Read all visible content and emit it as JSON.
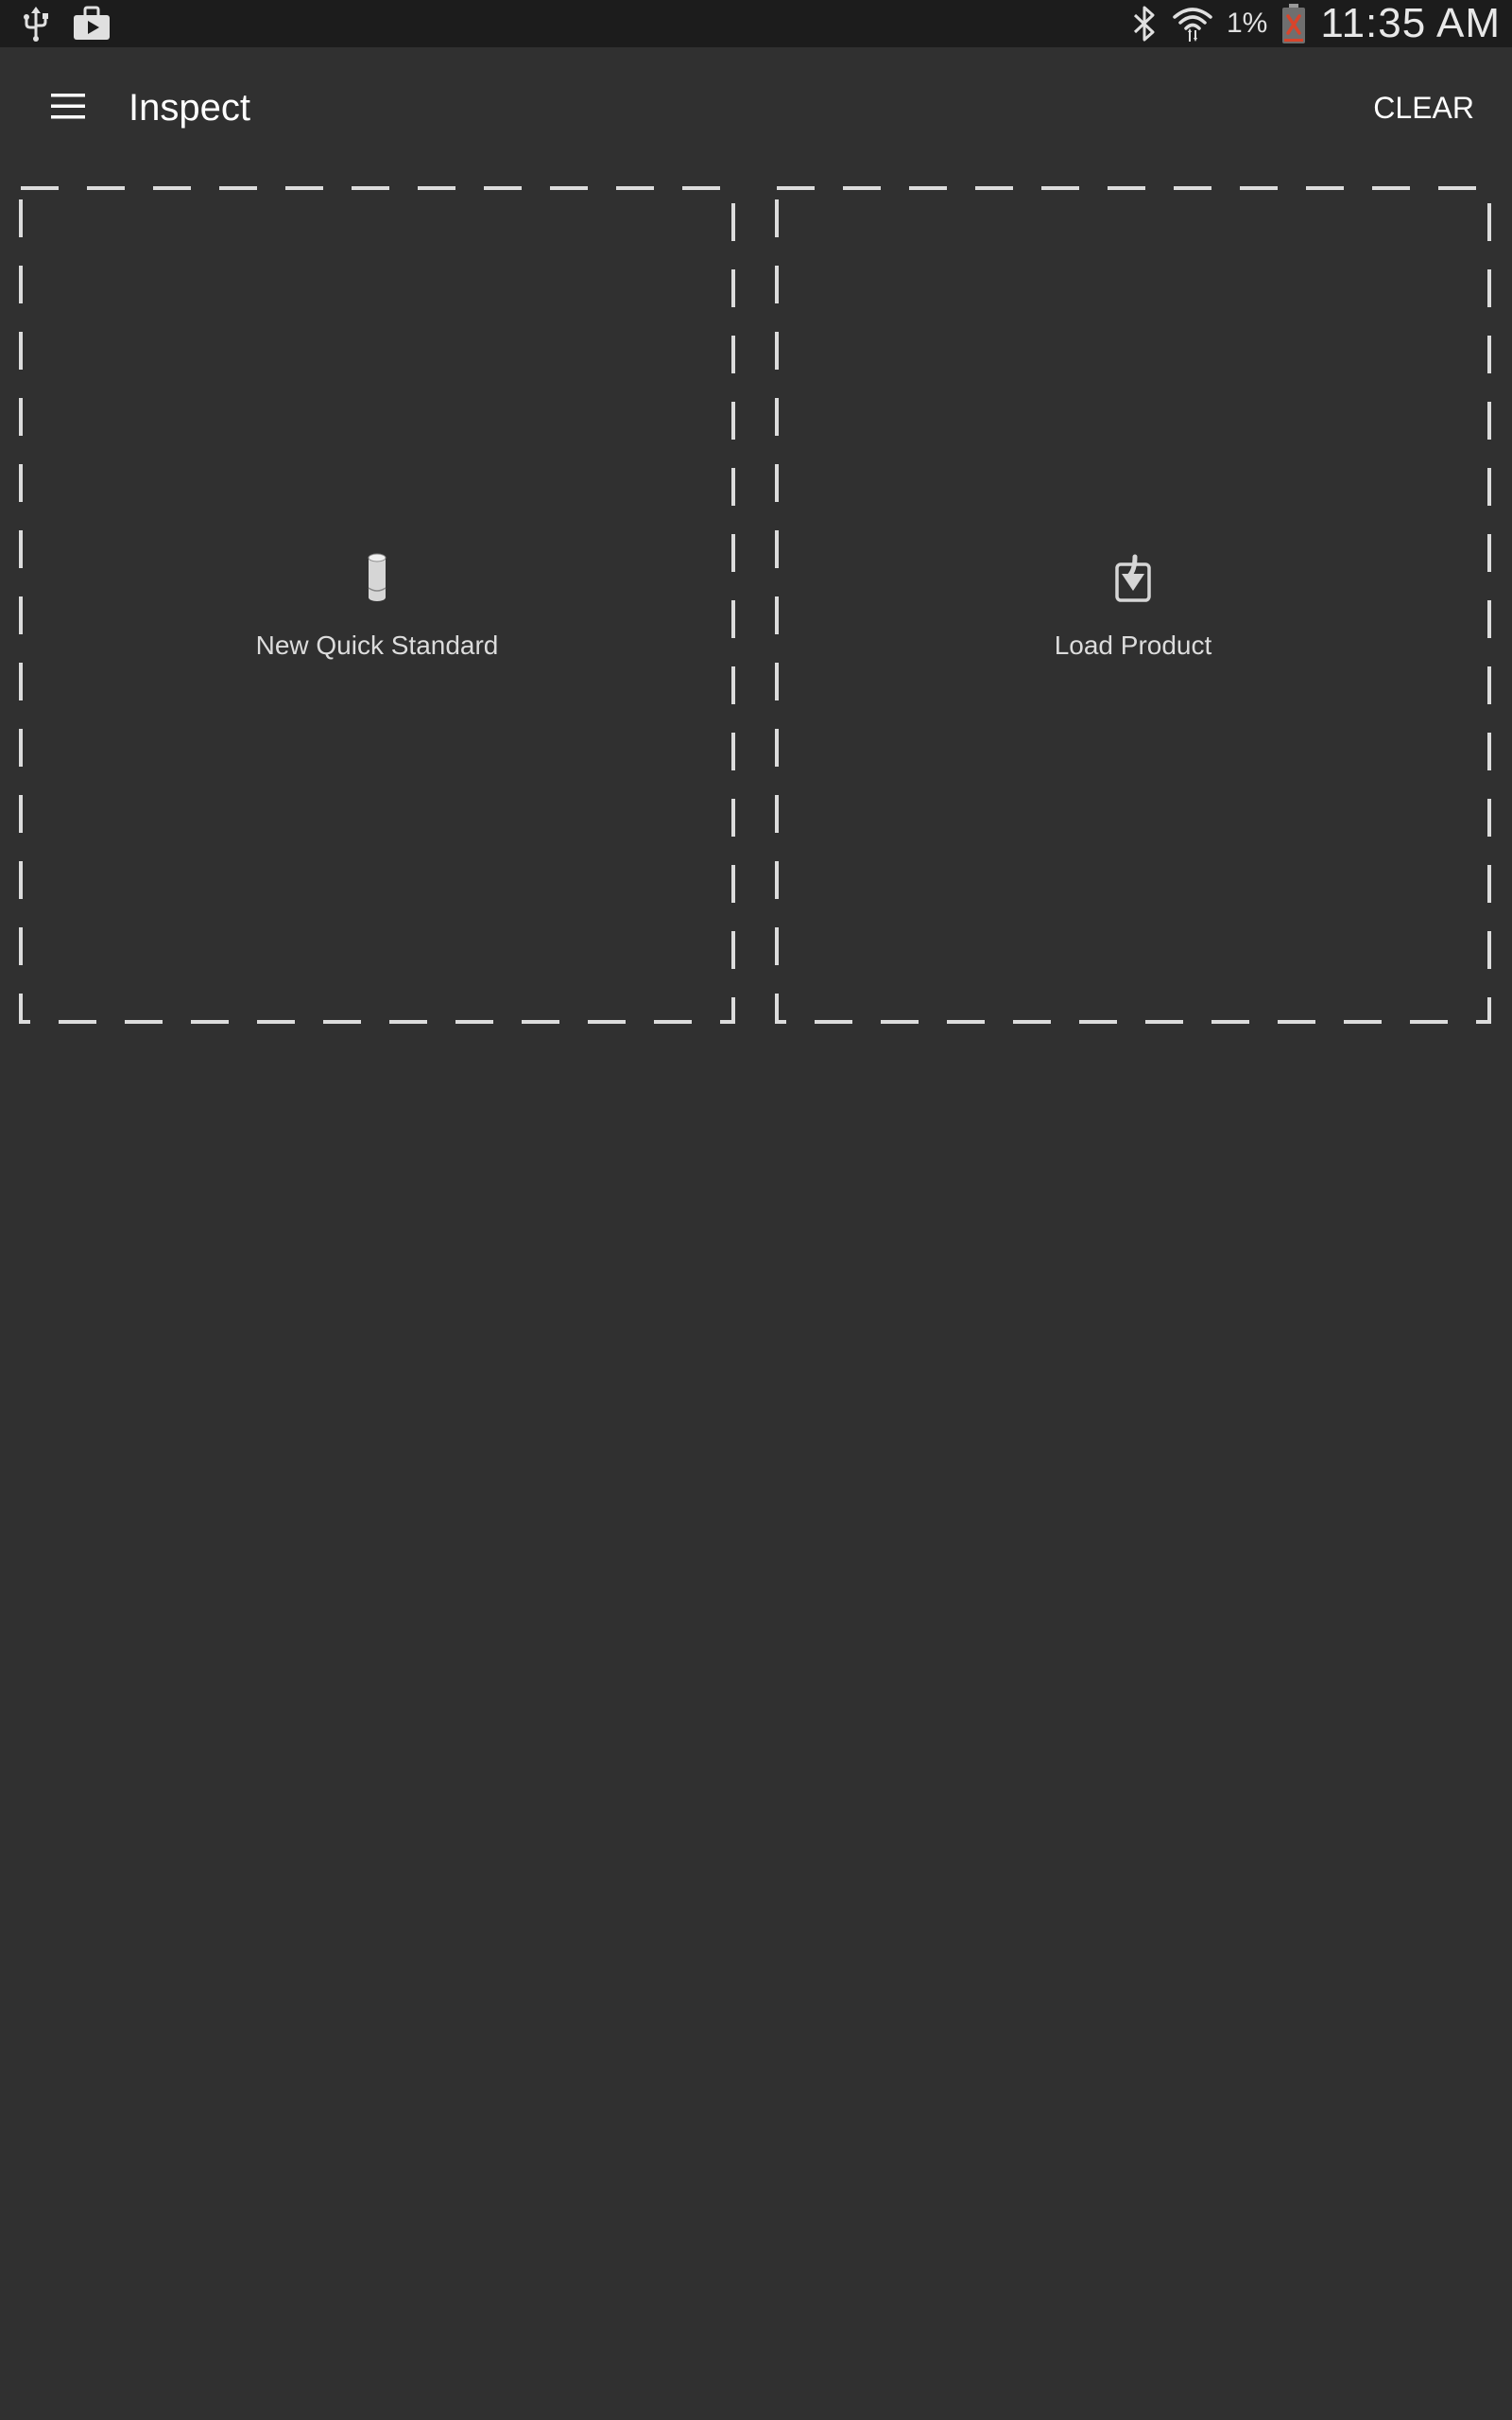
{
  "status_bar": {
    "left_icons": [
      "usb-icon",
      "briefcase-icon"
    ],
    "right_icons": [
      "bluetooth-icon",
      "wifi-icon",
      "battery-low-icon"
    ],
    "battery_percent": "1%",
    "time": "11:35 AM"
  },
  "app_bar": {
    "menu_icon": "hamburger-menu-icon",
    "title": "Inspect",
    "clear_label": "CLEAR"
  },
  "tiles": [
    {
      "label": "New Quick Standard",
      "icon": "cylinder-icon"
    },
    {
      "label": "Load Product",
      "icon": "load-download-icon"
    }
  ],
  "colors": {
    "background": "#303030",
    "status_bar": "#1c1c1c",
    "dashed_border": "#dcdcdc",
    "text": "#ffffff",
    "battery_warning": "#d9442b"
  }
}
